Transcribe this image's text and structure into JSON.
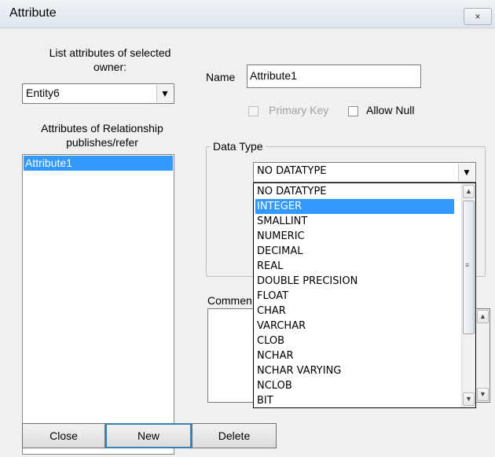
{
  "window": {
    "title": "Attribute",
    "close_glyph": "×"
  },
  "owner": {
    "label": "List attributes of selected owner:",
    "selected": "Entity6"
  },
  "attributes_list": {
    "label": "Attributes of Relationship publishes/refer",
    "items": [
      "Attribute1"
    ],
    "selected_index": 0
  },
  "name": {
    "label": "Name",
    "value": "Attribute1"
  },
  "primary_key": {
    "label": "Primary Key",
    "checked": false,
    "enabled": false
  },
  "allow_null": {
    "label": "Allow Null",
    "checked": false,
    "enabled": true
  },
  "data_type": {
    "group_label": "Data Type",
    "selected": "NO DATATYPE",
    "options": [
      "NO DATATYPE",
      "INTEGER",
      "SMALLINT",
      "NUMERIC",
      "DECIMAL",
      "REAL",
      "DOUBLE PRECISION",
      "FLOAT",
      "CHAR",
      "VARCHAR",
      "CLOB",
      "NCHAR",
      "NCHAR VARYING",
      "NCLOB",
      "BIT"
    ],
    "highlighted_index": 1
  },
  "comment": {
    "label": "Commen"
  },
  "buttons": {
    "close": "Close",
    "new": "New",
    "delete": "Delete"
  },
  "icons": {
    "dropdown_arrow": "▼",
    "scroll_up": "▲",
    "scroll_down": "▼",
    "grip": "≡"
  }
}
